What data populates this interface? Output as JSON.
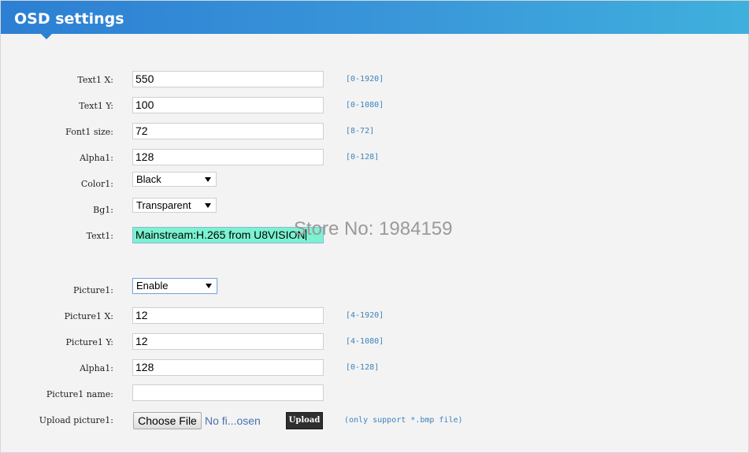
{
  "header": {
    "title": "OSD settings"
  },
  "fields": {
    "text1_x": {
      "label": "Text1 X:",
      "value": "550",
      "range": "[0-1920]"
    },
    "text1_y": {
      "label": "Text1 Y:",
      "value": "100",
      "range": "[0-1080]"
    },
    "font1_size": {
      "label": "Font1 size:",
      "value": "72",
      "range": "[8-72]"
    },
    "alpha1_text": {
      "label": "Alpha1:",
      "value": "128",
      "range": "[0-128]"
    },
    "color1": {
      "label": "Color1:",
      "selected": "Black"
    },
    "bg1": {
      "label": "Bg1:",
      "selected": "Transparent"
    },
    "text1": {
      "label": "Text1:",
      "value": "Mainstream:H.265 from U8VISION"
    },
    "picture1": {
      "label": "Picture1:",
      "selected": "Enable"
    },
    "picture1_x": {
      "label": "Picture1 X:",
      "value": "12",
      "range": "[4-1920]"
    },
    "picture1_y": {
      "label": "Picture1 Y:",
      "value": "12",
      "range": "[4-1080]"
    },
    "alpha1_picture": {
      "label": "Alpha1:",
      "value": "128",
      "range": "[0-128]"
    },
    "picture1_name": {
      "label": "Picture1 name:",
      "value": ""
    },
    "upload_picture1": {
      "label": "Upload picture1:",
      "choose_label": "Choose File",
      "status": "No fi...osen",
      "upload_label": "Upload",
      "note": "(only support *.bmp file)"
    }
  },
  "watermark": "Store No: 1984159",
  "colors": {
    "header_start": "#2c7fd3",
    "header_end": "#3fb0dd",
    "range_text": "#3b83bd",
    "text_highlight": "#7bf2d1"
  }
}
